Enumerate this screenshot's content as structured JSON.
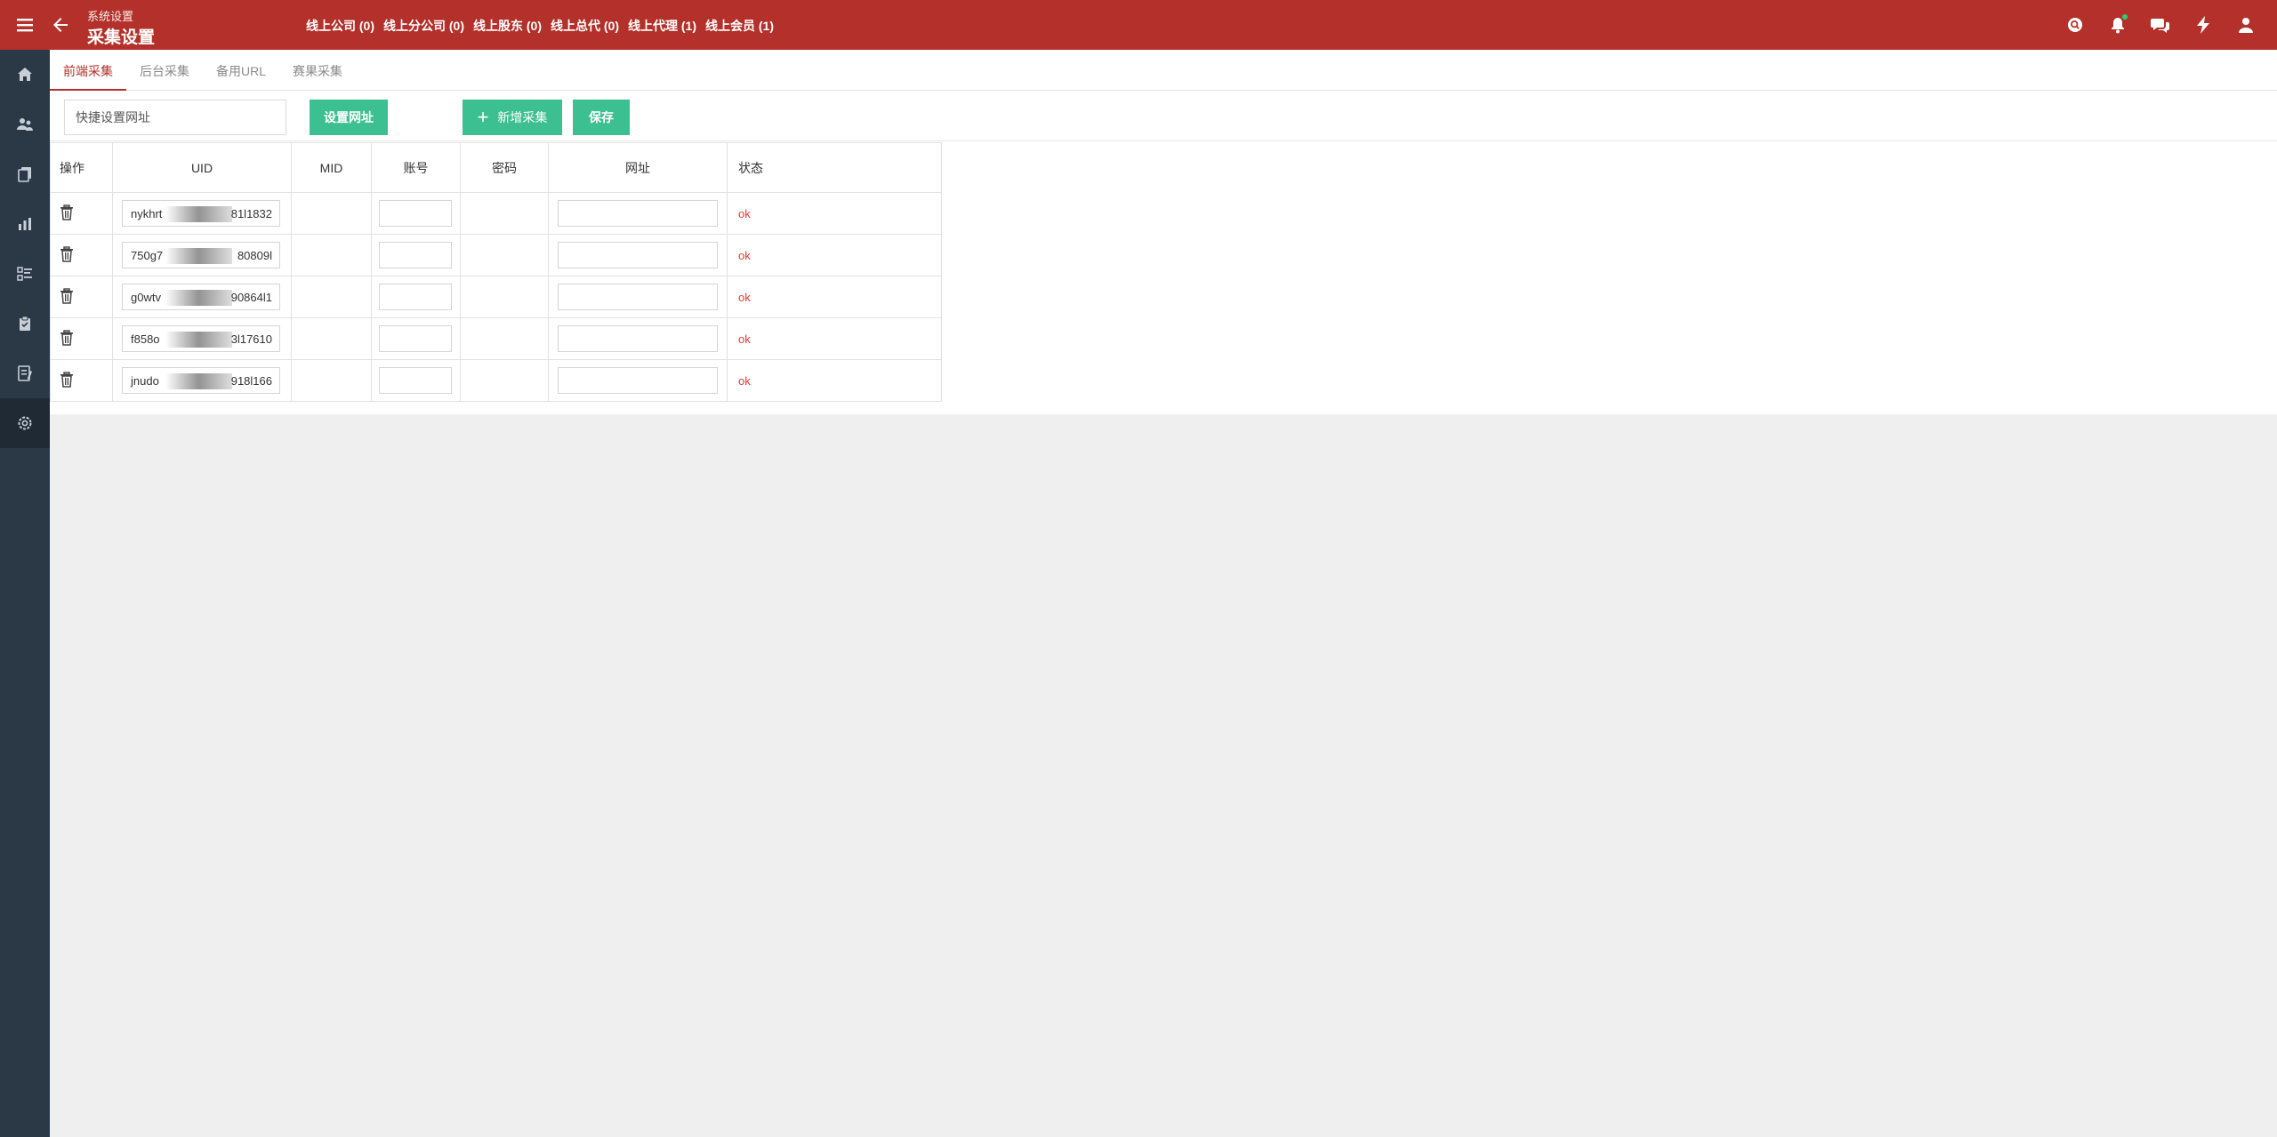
{
  "header": {
    "breadcrumb": "系统设置",
    "title": "采集设置",
    "online_stats": [
      "线上公司 (0)",
      "线上分公司 (0)",
      "线上股东 (0)",
      "线上总代 (0)",
      "线上代理 (1)",
      "线上会员 (1)"
    ],
    "icons": [
      "search-icon",
      "bell-icon",
      "chat-icon",
      "lightning-icon",
      "user-icon"
    ],
    "color": "#b3312a"
  },
  "sidebar": {
    "items": [
      {
        "icon": "home-icon"
      },
      {
        "icon": "users-icon"
      },
      {
        "icon": "documents-icon"
      },
      {
        "icon": "chart-icon"
      },
      {
        "icon": "list-icon"
      },
      {
        "icon": "clipboard-icon"
      },
      {
        "icon": "report-icon"
      },
      {
        "icon": "settings-icon",
        "active": true
      }
    ]
  },
  "tabs": [
    {
      "label": "前端采集",
      "active": true
    },
    {
      "label": "后台采集"
    },
    {
      "label": "备用URL"
    },
    {
      "label": "赛果采集"
    }
  ],
  "toolbar": {
    "quick_url_placeholder": "快捷设置网址",
    "set_url_label": "设置网址",
    "add_label": "新增采集",
    "save_label": "保存",
    "button_color": "#3cbf91"
  },
  "table": {
    "headers": {
      "op": "操作",
      "uid": "UID",
      "mid": "MID",
      "account": "账号",
      "password": "密码",
      "url": "网址",
      "status": "状态"
    },
    "rows": [
      {
        "uid_start": "nykhrt",
        "uid_end": "81l1832",
        "status": "ok"
      },
      {
        "uid_start": "750g7",
        "uid_end": "80809l",
        "status": "ok"
      },
      {
        "uid_start": "g0wtv",
        "uid_end": "90864l1",
        "status": "ok"
      },
      {
        "uid_start": "f858o",
        "uid_end": "3l17610",
        "status": "ok"
      },
      {
        "uid_start": "jnudo",
        "uid_end": "918l166",
        "status": "ok"
      }
    ]
  }
}
